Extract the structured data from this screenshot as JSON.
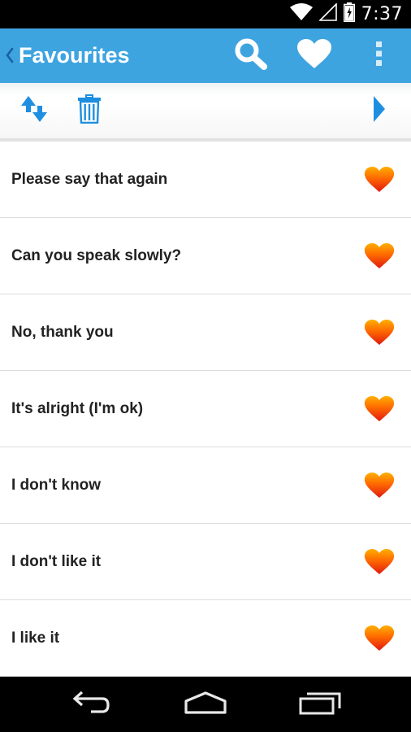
{
  "status_bar": {
    "time": "7:37",
    "icons": [
      "wifi-icon",
      "signal-icon",
      "battery-icon"
    ]
  },
  "action_bar": {
    "title": "Favourites",
    "icons": [
      "back-chevron-icon",
      "search-icon",
      "heart-icon",
      "overflow-menu-icon"
    ],
    "color": "#3ea4e0"
  },
  "toolbar": {
    "icons": [
      "sort-arrows-icon",
      "trash-icon",
      "play-arrow-icon"
    ],
    "icon_color": "#1e8fe0"
  },
  "favourites": [
    {
      "label": "Please say that again"
    },
    {
      "label": "Can you speak slowly?"
    },
    {
      "label": "No, thank you"
    },
    {
      "label": "It's alright (I'm ok)"
    },
    {
      "label": "I don't know"
    },
    {
      "label": "I don't like it"
    },
    {
      "label": "I like it"
    }
  ],
  "nav_bar": {
    "icons": [
      "nav-back-icon",
      "nav-home-icon",
      "nav-recents-icon"
    ]
  }
}
